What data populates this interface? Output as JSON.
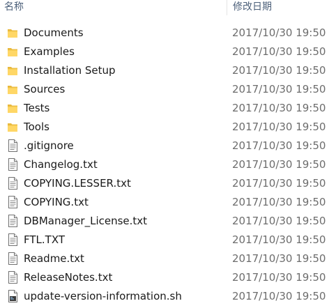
{
  "header": {
    "name_label": "名称",
    "date_label": "修改日期"
  },
  "files": [
    {
      "name": "Documents",
      "date": "2017/10/30 19:50",
      "icon": "folder-icon"
    },
    {
      "name": "Examples",
      "date": "2017/10/30 19:50",
      "icon": "folder-icon"
    },
    {
      "name": "Installation Setup",
      "date": "2017/10/30 19:50",
      "icon": "folder-icon"
    },
    {
      "name": "Sources",
      "date": "2017/10/30 19:50",
      "icon": "folder-icon"
    },
    {
      "name": "Tests",
      "date": "2017/10/30 19:50",
      "icon": "folder-icon"
    },
    {
      "name": "Tools",
      "date": "2017/10/30 19:50",
      "icon": "folder-icon"
    },
    {
      "name": ".gitignore",
      "date": "2017/10/30 19:50",
      "icon": "text-file-icon"
    },
    {
      "name": "Changelog.txt",
      "date": "2017/10/30 19:50",
      "icon": "text-file-icon"
    },
    {
      "name": "COPYING.LESSER.txt",
      "date": "2017/10/30 19:50",
      "icon": "text-file-icon"
    },
    {
      "name": "COPYING.txt",
      "date": "2017/10/30 19:50",
      "icon": "text-file-icon"
    },
    {
      "name": "DBManager_License.txt",
      "date": "2017/10/30 19:50",
      "icon": "text-file-icon"
    },
    {
      "name": "FTL.TXT",
      "date": "2017/10/30 19:50",
      "icon": "text-file-icon"
    },
    {
      "name": "Readme.txt",
      "date": "2017/10/30 19:50",
      "icon": "text-file-icon"
    },
    {
      "name": "ReleaseNotes.txt",
      "date": "2017/10/30 19:50",
      "icon": "text-file-icon"
    },
    {
      "name": "update-version-information.sh",
      "date": "2017/10/30 19:50",
      "icon": "shell-script-icon"
    }
  ]
}
